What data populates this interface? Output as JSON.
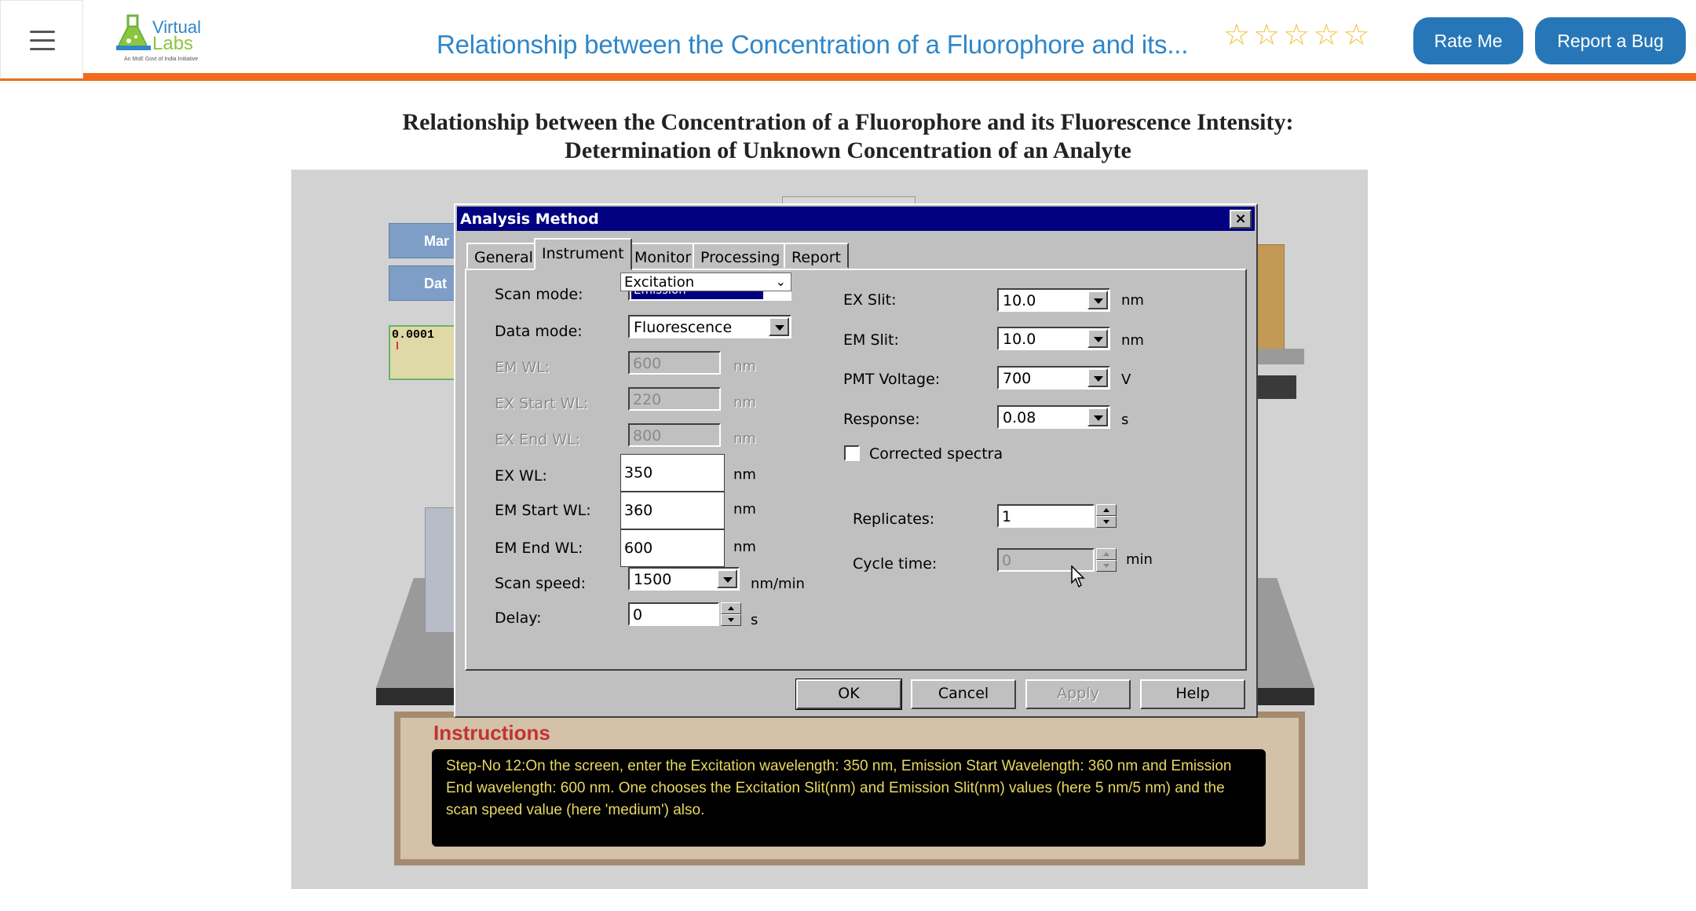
{
  "navbar": {
    "logo_top": "Virtual",
    "logo_bottom": "Labs",
    "logo_tagline": "An MoE Govt of India Initiative",
    "title": "Relationship between the Concentration of a Fluorophore and its...",
    "stars": [
      "☆",
      "☆",
      "☆",
      "☆",
      "☆"
    ],
    "rate_label": "Rate Me",
    "bug_label": "Report a Bug"
  },
  "page": {
    "title_line1": "Relationship between the Concentration of a Fluorophore and its Fluorescence Intensity:",
    "title_line2": "Determination of Unknown Concentration of an Analyte"
  },
  "background": {
    "tab1": "Mar",
    "tab2": "Dat",
    "readout": "0.0001"
  },
  "dialog": {
    "title": "Analysis Method",
    "close": "×",
    "tabs": [
      "General",
      "Instrument",
      "Monitor",
      "Processing",
      "Report"
    ],
    "active_tab": "Instrument",
    "scan_mode": {
      "label": "Scan mode:",
      "dropdown_value": "Excitation",
      "underlying_value": "Emission",
      "chevron": "⌄"
    },
    "data_mode": {
      "label": "Data mode:",
      "value": "Fluorescence"
    },
    "em_wl": {
      "label": "EM WL:",
      "value": "600",
      "unit": "nm"
    },
    "ex_start_wl": {
      "label": "EX Start WL:",
      "value": "220",
      "unit": "nm"
    },
    "ex_end_wl": {
      "label": "EX End WL:",
      "value": "800",
      "unit": "nm"
    },
    "ex_wl": {
      "label": "EX WL:",
      "value": "350",
      "unit": "nm"
    },
    "em_start_wl": {
      "label": "EM Start WL:",
      "value": "360",
      "unit": "nm"
    },
    "em_end_wl": {
      "label": "EM End WL:",
      "value": "600",
      "unit": "nm"
    },
    "scan_speed": {
      "label": "Scan speed:",
      "value": "1500",
      "unit": "nm/min"
    },
    "delay": {
      "label": "Delay:",
      "value": "0",
      "unit": "s"
    },
    "ex_slit": {
      "label": "EX Slit:",
      "value": "10.0",
      "unit": "nm"
    },
    "em_slit": {
      "label": "EM Slit:",
      "value": "10.0",
      "unit": "nm"
    },
    "pmt_voltage": {
      "label": "PMT Voltage:",
      "value": "700",
      "unit": "V"
    },
    "response": {
      "label": "Response:",
      "value": "0.08",
      "unit": "s"
    },
    "corrected_spectra": {
      "label": "Corrected spectra",
      "checked": false
    },
    "replicates": {
      "label": "Replicates:",
      "value": "1"
    },
    "cycle_time": {
      "label": "Cycle time:",
      "value": "0",
      "unit": "min"
    },
    "buttons": {
      "ok": "OK",
      "cancel": "Cancel",
      "apply": "Apply",
      "help": "Help"
    }
  },
  "instructions": {
    "title": "Instructions",
    "text": "Step-No 12:On the screen, enter the Excitation wavelength: 350 nm, Emission Start Wavelength: 360 nm and Emission End wavelength: 600 nm. One chooses the Excitation Slit(nm) and Emission Slit(nm) values (here 5 nm/5 nm) and the scan speed value (here 'medium') also."
  }
}
